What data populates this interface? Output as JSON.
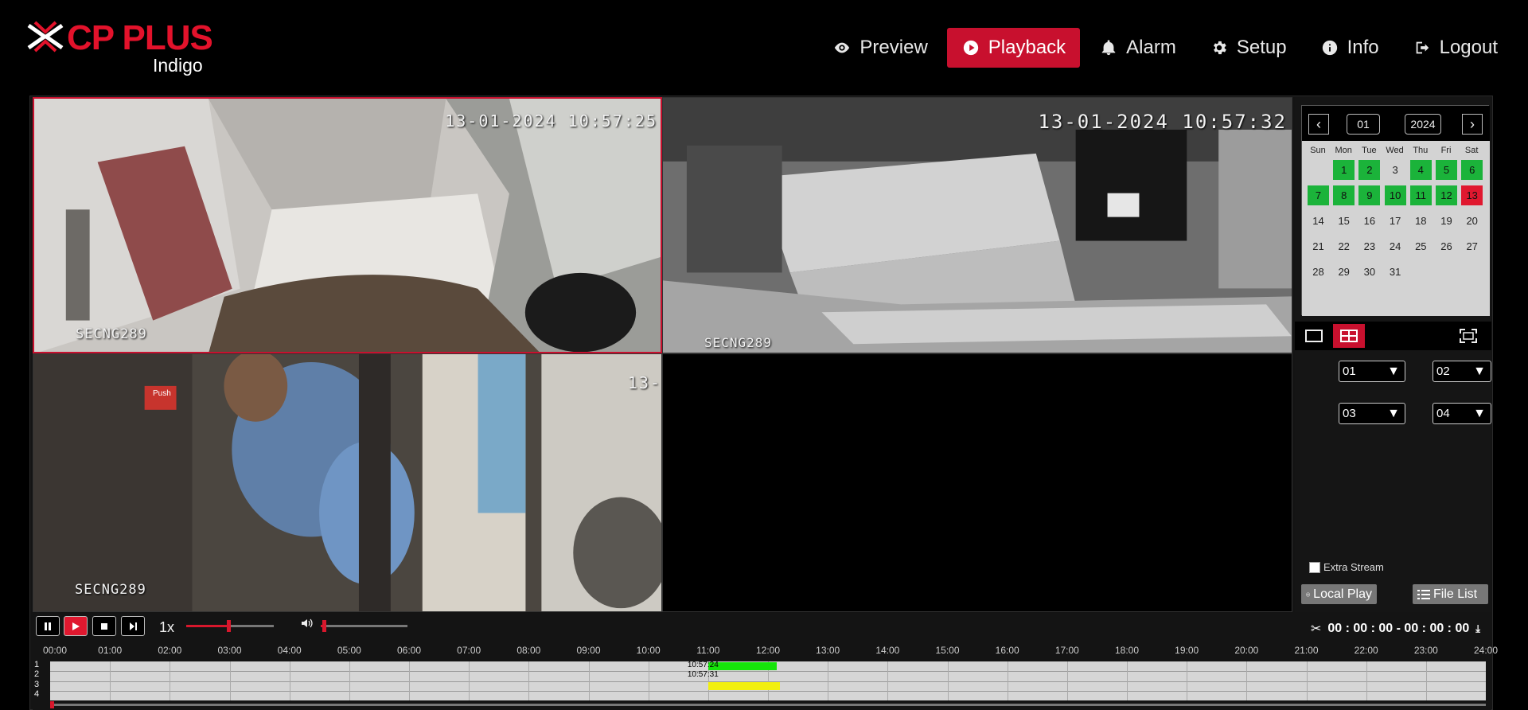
{
  "brand": {
    "name": "CP PLUS",
    "sub": "Indigo",
    "color": "#e3122b"
  },
  "nav": [
    {
      "label": "Preview",
      "icon": "eye-icon",
      "active": false
    },
    {
      "label": "Playback",
      "icon": "play-circle-icon",
      "active": true
    },
    {
      "label": "Alarm",
      "icon": "bell-icon",
      "active": false
    },
    {
      "label": "Setup",
      "icon": "gear-icon",
      "active": false
    },
    {
      "label": "Info",
      "icon": "info-icon",
      "active": false
    },
    {
      "label": "Logout",
      "icon": "logout-icon",
      "active": false
    }
  ],
  "cameras": [
    {
      "time": "13-01-2024 10:57:25",
      "name": "SECNG289",
      "selected": true
    },
    {
      "time": "13-01-2024 10:57:32",
      "name": "SECNG289",
      "selected": false
    },
    {
      "time": "13-",
      "name": "SECNG289",
      "selected": false,
      "sign": "Push"
    },
    {
      "time": "",
      "name": "",
      "selected": false
    }
  ],
  "calendar": {
    "month": "01",
    "year": "2024",
    "weekdays": [
      "Sun",
      "Mon",
      "Tue",
      "Wed",
      "Thu",
      "Fri",
      "Sat"
    ],
    "first_weekday": 1,
    "days_in_month": 31,
    "recorded_days": [
      1,
      2,
      4,
      5,
      6,
      7,
      8,
      9,
      10,
      11,
      12
    ],
    "today": 13,
    "colors": {
      "recorded": "#1bb33a",
      "today": "#e0182f"
    }
  },
  "channels": {
    "selects": [
      "01",
      "02",
      "03",
      "04"
    ]
  },
  "extra_stream": {
    "label": "Extra Stream",
    "checked": false
  },
  "buttons": {
    "local_play": "Local Play",
    "file_list": "File List"
  },
  "playback": {
    "speed": "1x",
    "progress": 0.48,
    "volume": 0.02,
    "clip_range": "00 : 00 : 00 - 00 : 00 : 00"
  },
  "timeline": {
    "hours": [
      "00:00",
      "01:00",
      "02:00",
      "03:00",
      "04:00",
      "05:00",
      "06:00",
      "07:00",
      "08:00",
      "09:00",
      "10:00",
      "11:00",
      "12:00",
      "13:00",
      "14:00",
      "15:00",
      "16:00",
      "17:00",
      "18:00",
      "19:00",
      "20:00",
      "21:00",
      "22:00",
      "23:00",
      "24:00"
    ],
    "tracks": [
      "1",
      "2",
      "3",
      "4"
    ],
    "tags": [
      "10:57:24",
      "10:57:31"
    ],
    "segments": [
      {
        "track": 1,
        "start_hour": 11.0,
        "end_hour": 12.15,
        "color": "#16e40a"
      },
      {
        "track": 3,
        "start_hour": 11.0,
        "end_hour": 12.2,
        "color": "#f1ef10"
      }
    ],
    "accent": "#d8172c"
  }
}
